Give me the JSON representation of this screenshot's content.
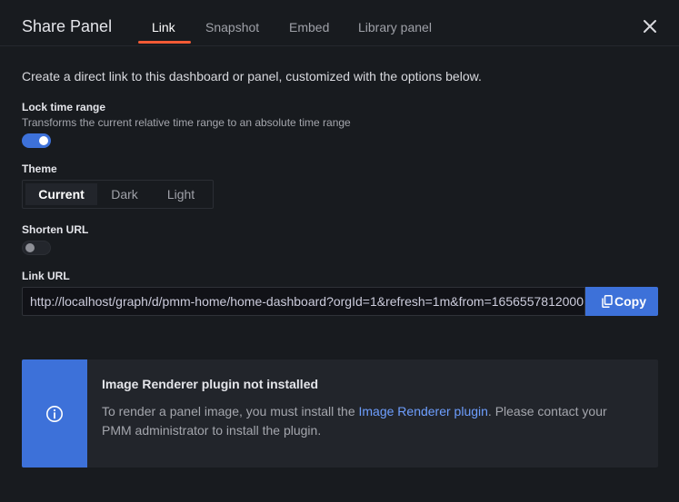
{
  "header": {
    "title": "Share Panel",
    "tabs": [
      {
        "label": "Link",
        "active": true
      },
      {
        "label": "Snapshot",
        "active": false
      },
      {
        "label": "Embed",
        "active": false
      },
      {
        "label": "Library panel",
        "active": false
      }
    ],
    "close_icon": "close-icon"
  },
  "description": "Create a direct link to this dashboard or panel, customized with the options below.",
  "lock_time_range": {
    "label": "Lock time range",
    "description": "Transforms the current relative time range to an absolute time range",
    "enabled": true
  },
  "theme": {
    "label": "Theme",
    "options": [
      "Current",
      "Dark",
      "Light"
    ],
    "selected": "Current"
  },
  "shorten_url": {
    "label": "Shorten URL",
    "enabled": false
  },
  "link_url": {
    "label": "Link URL",
    "value": "http://localhost/graph/d/pmm-home/home-dashboard?orgId=1&refresh=1m&from=1656557812000",
    "copy_label": "Copy",
    "copy_icon": "copy-icon"
  },
  "alert": {
    "icon": "info-circle-icon",
    "title": "Image Renderer plugin not installed",
    "body_before": "To render a panel image, you must install the ",
    "link_text": "Image Renderer plugin",
    "body_after": ". Please contact your PMM administrator to install the plugin."
  },
  "colors": {
    "background": "#181b1f",
    "accent_blue": "#3d71d9",
    "tab_underline": "#f35b35",
    "link": "#6e9fff"
  }
}
